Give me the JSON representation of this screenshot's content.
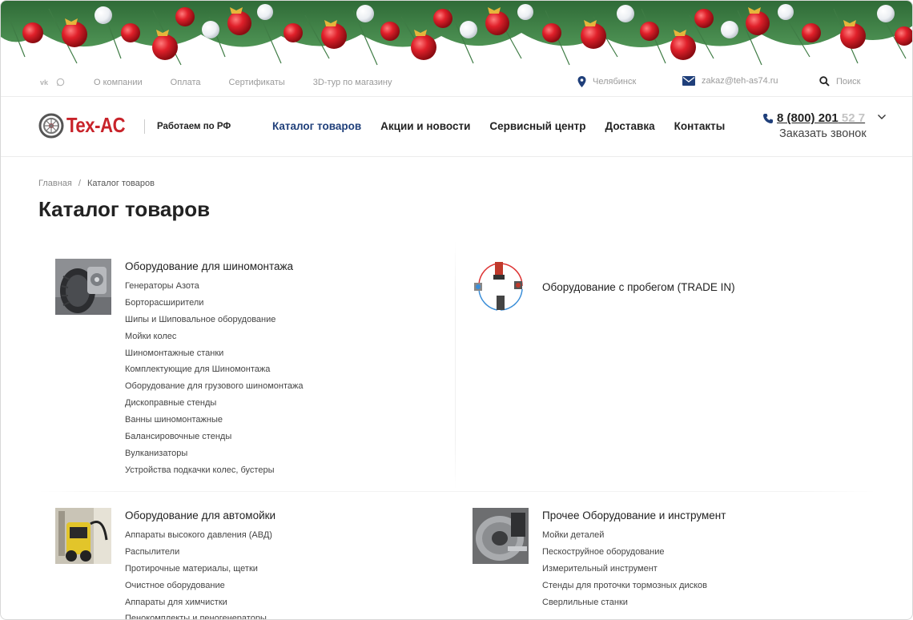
{
  "colors": {
    "brand_red": "#c8232a",
    "nav_active": "#1f3f7a",
    "muted": "#9a9a9a"
  },
  "topbar": {
    "social": [
      {
        "name": "vk-icon",
        "glyph": "vk"
      },
      {
        "name": "whatsapp-icon",
        "glyph": "◌"
      }
    ],
    "links": [
      "О компании",
      "Оплата",
      "Сертификаты",
      "3D-тур по магазину"
    ],
    "city": "Челябинск",
    "email": "zakaz@teh-as74.ru",
    "search_label": "Поиск"
  },
  "header": {
    "logo_text": "Tex-AC",
    "slogan": "Работаем по РФ",
    "nav": [
      "Каталог товаров",
      "Акции и новости",
      "Сервисный центр",
      "Доставка",
      "Контакты"
    ],
    "phone_main": "8 (800) 201",
    "phone_faded": " 52 7",
    "callback": "Заказать звонок"
  },
  "breadcrumb": {
    "home": "Главная",
    "separator": "/",
    "current": "Каталог товаров"
  },
  "page_title": "Каталог товаров",
  "categories": [
    {
      "title": "Оборудование для шиномонтажа",
      "items": [
        "Генераторы Азота",
        "Борторасширители",
        "Шипы и Шиповальное оборудование",
        "Мойки колес",
        "Шиномонтажные станки",
        "Комплектующие для Шиномонтажа",
        "Оборудование для грузового шиномонтажа",
        "Дископравные стенды",
        "Ванны шиномонтажные",
        "Балансировочные стенды",
        "Вулканизаторы",
        "Устройства подкачки колес, бустеры"
      ]
    },
    {
      "title": "Оборудование с пробегом (TRADE IN)",
      "items": []
    },
    {
      "title": "Оборудование для автомойки",
      "items": [
        "Аппараты высокого давления (АВД)",
        "Распылители",
        "Протирочные материалы, щетки",
        "Очистное оборудование",
        "Аппараты для химчистки",
        "Пенокомплекты и пеногенераторы"
      ]
    },
    {
      "title": "Прочее Оборудование и инструмент",
      "items": [
        "Мойки деталей",
        "Пескоструйное оборудование",
        "Измерительный инструмент",
        "Стенды для проточки тормозных дисков",
        "Сверлильные станки"
      ]
    }
  ]
}
